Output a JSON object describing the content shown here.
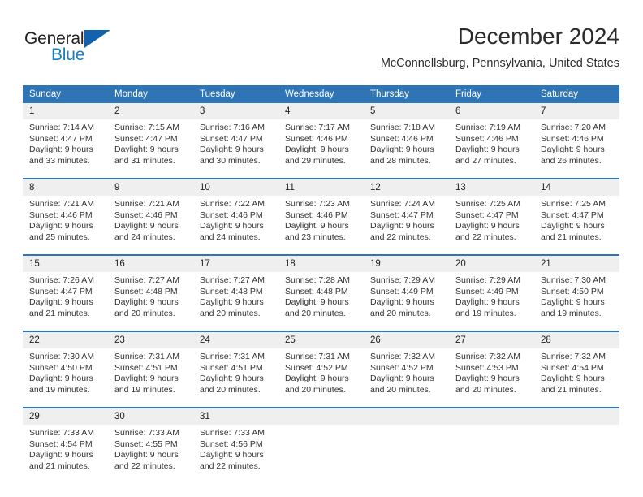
{
  "brand": {
    "name_part1": "General",
    "name_part2": "Blue"
  },
  "header": {
    "title": "December 2024",
    "location": "McConnellsburg, Pennsylvania, United States"
  },
  "colors": {
    "header_blue": "#2f75b5",
    "daynum_band": "#efefef",
    "logo_blue": "#1a7fc1",
    "logo_triangle": "#1262ad"
  },
  "labels": {
    "sunrise_prefix": "Sunrise:",
    "sunset_prefix": "Sunset:",
    "daylight_prefix": "Daylight:"
  },
  "weekday_headers": [
    "Sunday",
    "Monday",
    "Tuesday",
    "Wednesday",
    "Thursday",
    "Friday",
    "Saturday"
  ],
  "weeks": [
    [
      {
        "day": "1",
        "sunrise": "Sunrise: 7:14 AM",
        "sunset": "Sunset: 4:47 PM",
        "daylight_line1": "Daylight: 9 hours",
        "daylight_line2": "and 33 minutes."
      },
      {
        "day": "2",
        "sunrise": "Sunrise: 7:15 AM",
        "sunset": "Sunset: 4:47 PM",
        "daylight_line1": "Daylight: 9 hours",
        "daylight_line2": "and 31 minutes."
      },
      {
        "day": "3",
        "sunrise": "Sunrise: 7:16 AM",
        "sunset": "Sunset: 4:47 PM",
        "daylight_line1": "Daylight: 9 hours",
        "daylight_line2": "and 30 minutes."
      },
      {
        "day": "4",
        "sunrise": "Sunrise: 7:17 AM",
        "sunset": "Sunset: 4:46 PM",
        "daylight_line1": "Daylight: 9 hours",
        "daylight_line2": "and 29 minutes."
      },
      {
        "day": "5",
        "sunrise": "Sunrise: 7:18 AM",
        "sunset": "Sunset: 4:46 PM",
        "daylight_line1": "Daylight: 9 hours",
        "daylight_line2": "and 28 minutes."
      },
      {
        "day": "6",
        "sunrise": "Sunrise: 7:19 AM",
        "sunset": "Sunset: 4:46 PM",
        "daylight_line1": "Daylight: 9 hours",
        "daylight_line2": "and 27 minutes."
      },
      {
        "day": "7",
        "sunrise": "Sunrise: 7:20 AM",
        "sunset": "Sunset: 4:46 PM",
        "daylight_line1": "Daylight: 9 hours",
        "daylight_line2": "and 26 minutes."
      }
    ],
    [
      {
        "day": "8",
        "sunrise": "Sunrise: 7:21 AM",
        "sunset": "Sunset: 4:46 PM",
        "daylight_line1": "Daylight: 9 hours",
        "daylight_line2": "and 25 minutes."
      },
      {
        "day": "9",
        "sunrise": "Sunrise: 7:21 AM",
        "sunset": "Sunset: 4:46 PM",
        "daylight_line1": "Daylight: 9 hours",
        "daylight_line2": "and 24 minutes."
      },
      {
        "day": "10",
        "sunrise": "Sunrise: 7:22 AM",
        "sunset": "Sunset: 4:46 PM",
        "daylight_line1": "Daylight: 9 hours",
        "daylight_line2": "and 24 minutes."
      },
      {
        "day": "11",
        "sunrise": "Sunrise: 7:23 AM",
        "sunset": "Sunset: 4:46 PM",
        "daylight_line1": "Daylight: 9 hours",
        "daylight_line2": "and 23 minutes."
      },
      {
        "day": "12",
        "sunrise": "Sunrise: 7:24 AM",
        "sunset": "Sunset: 4:47 PM",
        "daylight_line1": "Daylight: 9 hours",
        "daylight_line2": "and 22 minutes."
      },
      {
        "day": "13",
        "sunrise": "Sunrise: 7:25 AM",
        "sunset": "Sunset: 4:47 PM",
        "daylight_line1": "Daylight: 9 hours",
        "daylight_line2": "and 22 minutes."
      },
      {
        "day": "14",
        "sunrise": "Sunrise: 7:25 AM",
        "sunset": "Sunset: 4:47 PM",
        "daylight_line1": "Daylight: 9 hours",
        "daylight_line2": "and 21 minutes."
      }
    ],
    [
      {
        "day": "15",
        "sunrise": "Sunrise: 7:26 AM",
        "sunset": "Sunset: 4:47 PM",
        "daylight_line1": "Daylight: 9 hours",
        "daylight_line2": "and 21 minutes."
      },
      {
        "day": "16",
        "sunrise": "Sunrise: 7:27 AM",
        "sunset": "Sunset: 4:48 PM",
        "daylight_line1": "Daylight: 9 hours",
        "daylight_line2": "and 20 minutes."
      },
      {
        "day": "17",
        "sunrise": "Sunrise: 7:27 AM",
        "sunset": "Sunset: 4:48 PM",
        "daylight_line1": "Daylight: 9 hours",
        "daylight_line2": "and 20 minutes."
      },
      {
        "day": "18",
        "sunrise": "Sunrise: 7:28 AM",
        "sunset": "Sunset: 4:48 PM",
        "daylight_line1": "Daylight: 9 hours",
        "daylight_line2": "and 20 minutes."
      },
      {
        "day": "19",
        "sunrise": "Sunrise: 7:29 AM",
        "sunset": "Sunset: 4:49 PM",
        "daylight_line1": "Daylight: 9 hours",
        "daylight_line2": "and 20 minutes."
      },
      {
        "day": "20",
        "sunrise": "Sunrise: 7:29 AM",
        "sunset": "Sunset: 4:49 PM",
        "daylight_line1": "Daylight: 9 hours",
        "daylight_line2": "and 19 minutes."
      },
      {
        "day": "21",
        "sunrise": "Sunrise: 7:30 AM",
        "sunset": "Sunset: 4:50 PM",
        "daylight_line1": "Daylight: 9 hours",
        "daylight_line2": "and 19 minutes."
      }
    ],
    [
      {
        "day": "22",
        "sunrise": "Sunrise: 7:30 AM",
        "sunset": "Sunset: 4:50 PM",
        "daylight_line1": "Daylight: 9 hours",
        "daylight_line2": "and 19 minutes."
      },
      {
        "day": "23",
        "sunrise": "Sunrise: 7:31 AM",
        "sunset": "Sunset: 4:51 PM",
        "daylight_line1": "Daylight: 9 hours",
        "daylight_line2": "and 19 minutes."
      },
      {
        "day": "24",
        "sunrise": "Sunrise: 7:31 AM",
        "sunset": "Sunset: 4:51 PM",
        "daylight_line1": "Daylight: 9 hours",
        "daylight_line2": "and 20 minutes."
      },
      {
        "day": "25",
        "sunrise": "Sunrise: 7:31 AM",
        "sunset": "Sunset: 4:52 PM",
        "daylight_line1": "Daylight: 9 hours",
        "daylight_line2": "and 20 minutes."
      },
      {
        "day": "26",
        "sunrise": "Sunrise: 7:32 AM",
        "sunset": "Sunset: 4:52 PM",
        "daylight_line1": "Daylight: 9 hours",
        "daylight_line2": "and 20 minutes."
      },
      {
        "day": "27",
        "sunrise": "Sunrise: 7:32 AM",
        "sunset": "Sunset: 4:53 PM",
        "daylight_line1": "Daylight: 9 hours",
        "daylight_line2": "and 20 minutes."
      },
      {
        "day": "28",
        "sunrise": "Sunrise: 7:32 AM",
        "sunset": "Sunset: 4:54 PM",
        "daylight_line1": "Daylight: 9 hours",
        "daylight_line2": "and 21 minutes."
      }
    ],
    [
      {
        "day": "29",
        "sunrise": "Sunrise: 7:33 AM",
        "sunset": "Sunset: 4:54 PM",
        "daylight_line1": "Daylight: 9 hours",
        "daylight_line2": "and 21 minutes."
      },
      {
        "day": "30",
        "sunrise": "Sunrise: 7:33 AM",
        "sunset": "Sunset: 4:55 PM",
        "daylight_line1": "Daylight: 9 hours",
        "daylight_line2": "and 22 minutes."
      },
      {
        "day": "31",
        "sunrise": "Sunrise: 7:33 AM",
        "sunset": "Sunset: 4:56 PM",
        "daylight_line1": "Daylight: 9 hours",
        "daylight_line2": "and 22 minutes."
      },
      {
        "day": "",
        "sunrise": "",
        "sunset": "",
        "daylight_line1": "",
        "daylight_line2": ""
      },
      {
        "day": "",
        "sunrise": "",
        "sunset": "",
        "daylight_line1": "",
        "daylight_line2": ""
      },
      {
        "day": "",
        "sunrise": "",
        "sunset": "",
        "daylight_line1": "",
        "daylight_line2": ""
      },
      {
        "day": "",
        "sunrise": "",
        "sunset": "",
        "daylight_line1": "",
        "daylight_line2": ""
      }
    ]
  ]
}
